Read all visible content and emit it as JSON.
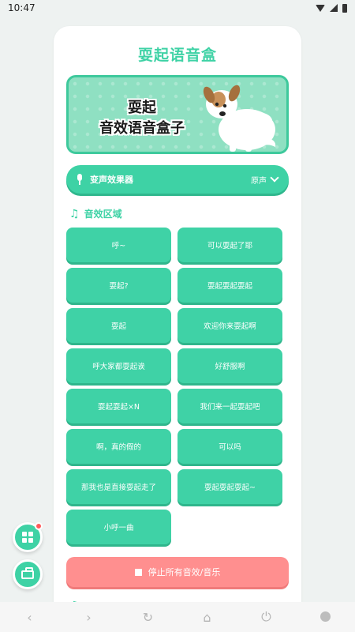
{
  "status_bar": {
    "time": "10:47"
  },
  "app": {
    "title": "耍起语音盒"
  },
  "banner": {
    "line1": "耍起",
    "line2": "音效语音盒子"
  },
  "voice_changer": {
    "label": "变声效果器",
    "value": "原声"
  },
  "sound_section": {
    "heading": "音效区域"
  },
  "sounds": [
    "呼~",
    "可以耍起了耶",
    "耍起?",
    "耍起耍起耍起",
    "耍起",
    "欢迎你来耍起啊",
    "呼大家都耍起诶",
    "好舒服啊",
    "耍起耍起×N",
    "我们来一起耍起吧",
    "啊，真的假的",
    "可以吗",
    "那我也是直接耍起走了",
    "耍起耍起耍起~",
    "小呼一曲"
  ],
  "stop_button": {
    "label": "停止所有音效/音乐"
  },
  "colors": {
    "accent": "#3ed2a5",
    "stop": "#ff8f8f",
    "badge": "#ff5a5a"
  },
  "icons": {
    "fab_grid": "grid-icon",
    "fab_box": "toolbox-icon",
    "nav": [
      "back-icon",
      "forward-icon",
      "refresh-icon",
      "home-icon",
      "power-icon",
      "circle-icon"
    ]
  }
}
